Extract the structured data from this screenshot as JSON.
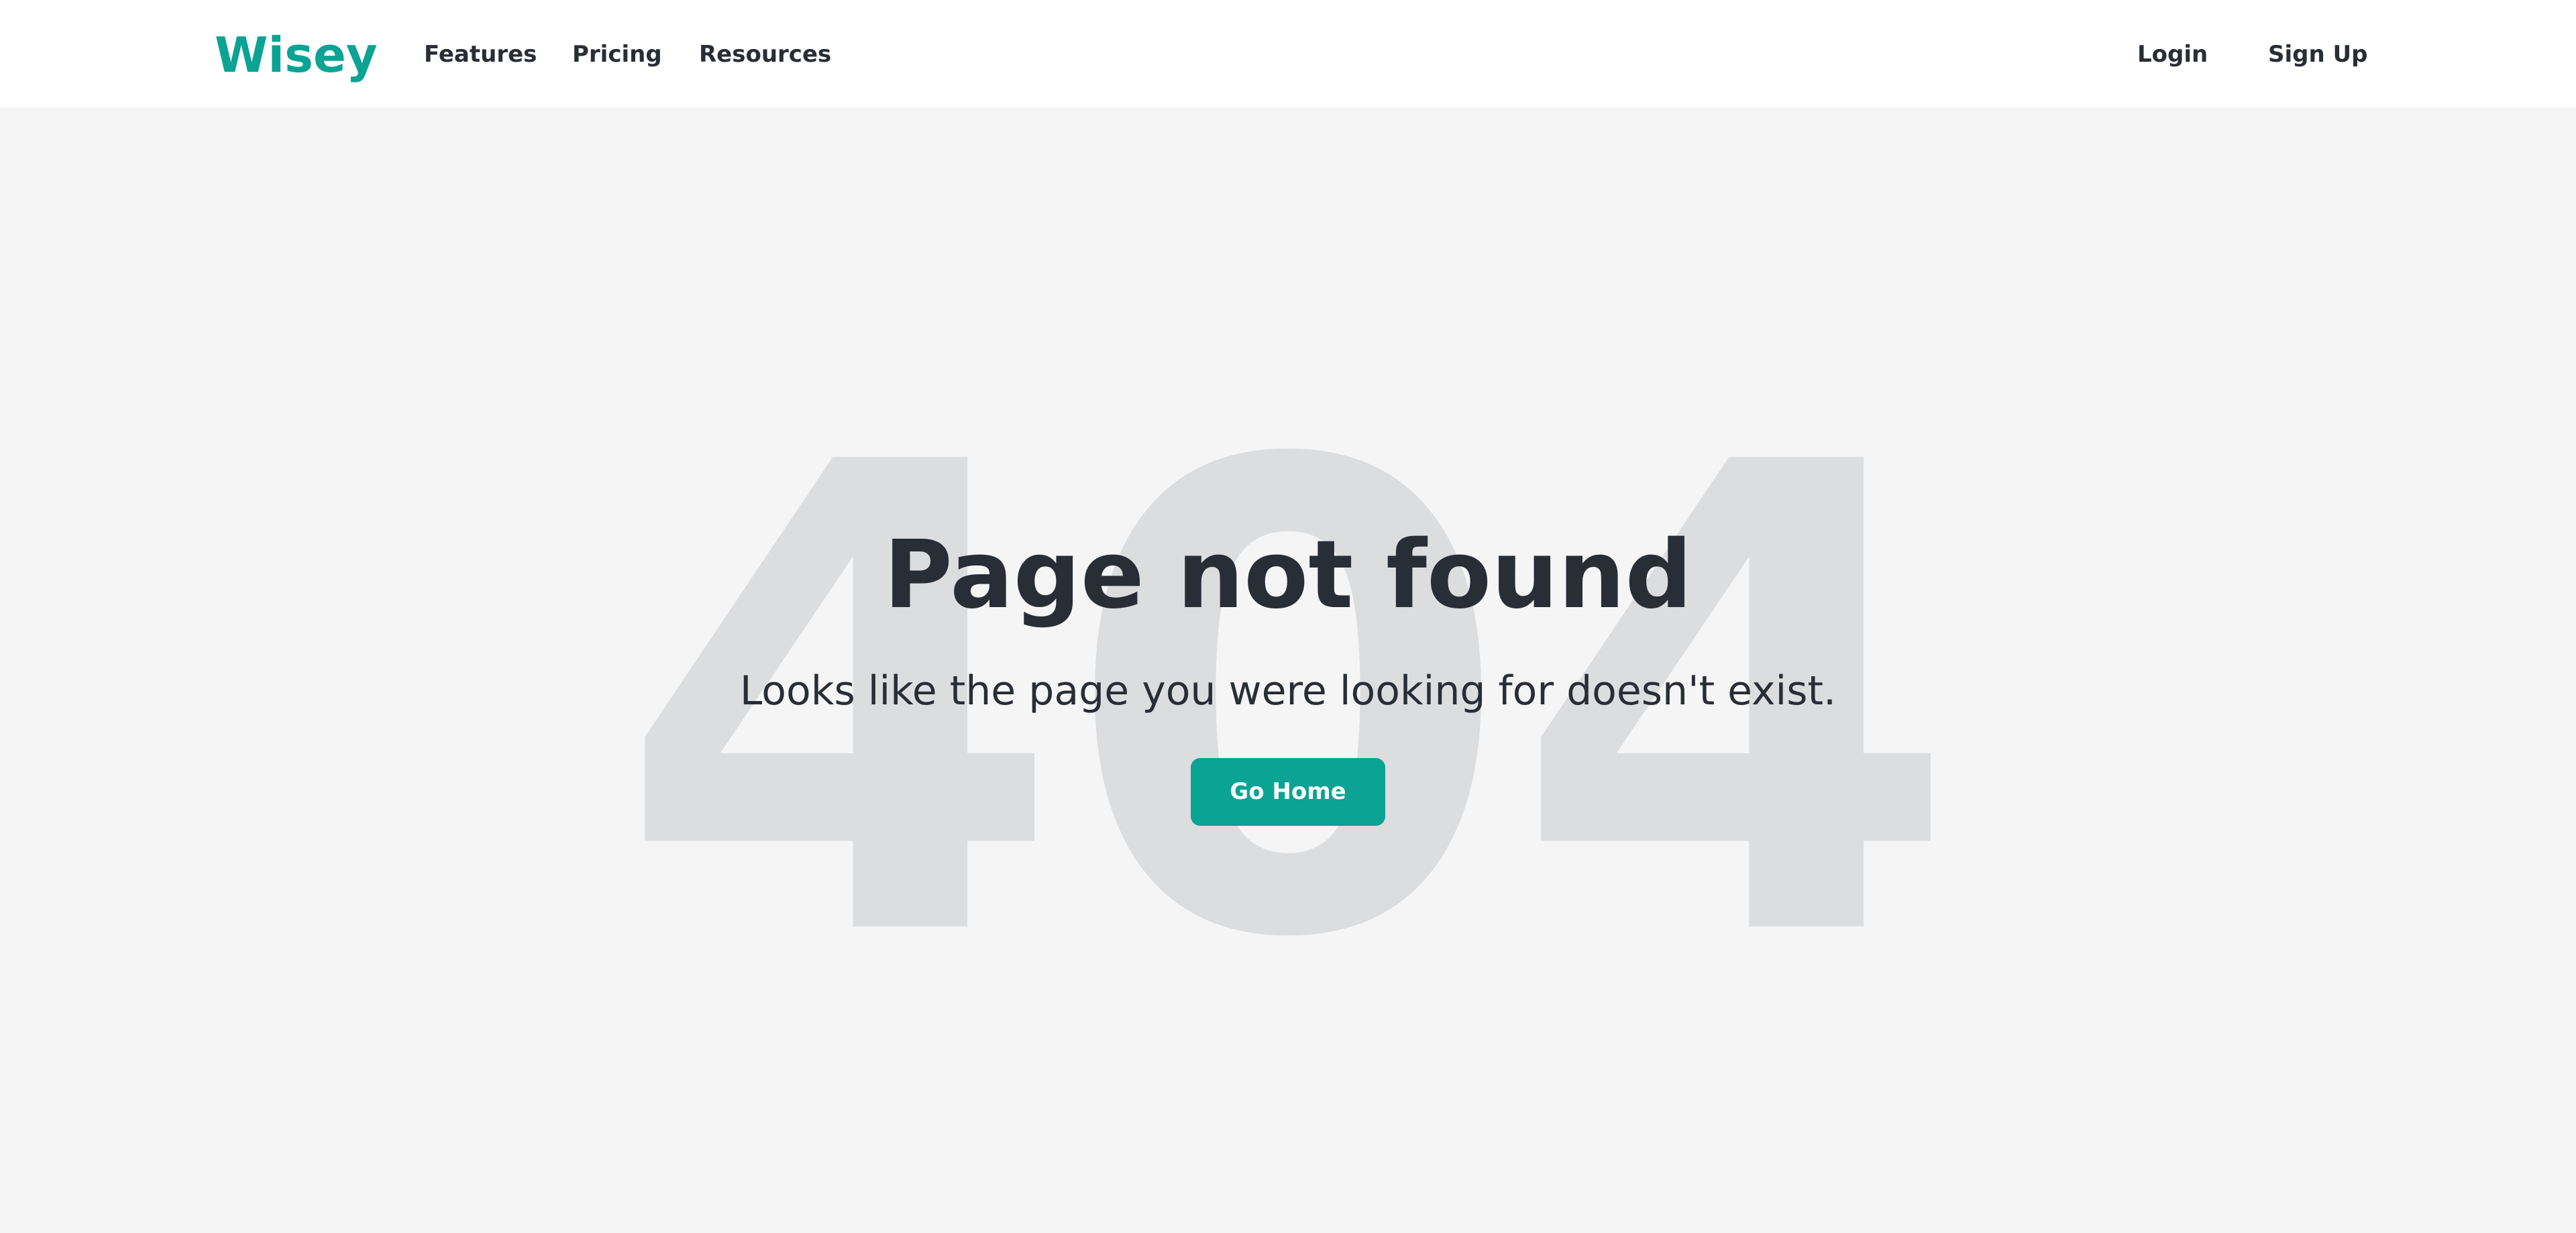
{
  "brand": {
    "name": "Wisey",
    "color": "#0aa394"
  },
  "nav": {
    "left_items": [
      {
        "label": "Features"
      },
      {
        "label": "Pricing"
      },
      {
        "label": "Resources"
      }
    ],
    "right_items": [
      {
        "label": "Login"
      },
      {
        "label": "Sign Up"
      }
    ]
  },
  "error": {
    "code": "404",
    "title": "Page not found",
    "message": "Looks like the page you were looking for doesn't exist.",
    "button_label": "Go Home"
  },
  "colors": {
    "accent": "#0aa394",
    "text": "#292d36",
    "background": "#f5f5f5",
    "watermark": "#dcdddf"
  }
}
